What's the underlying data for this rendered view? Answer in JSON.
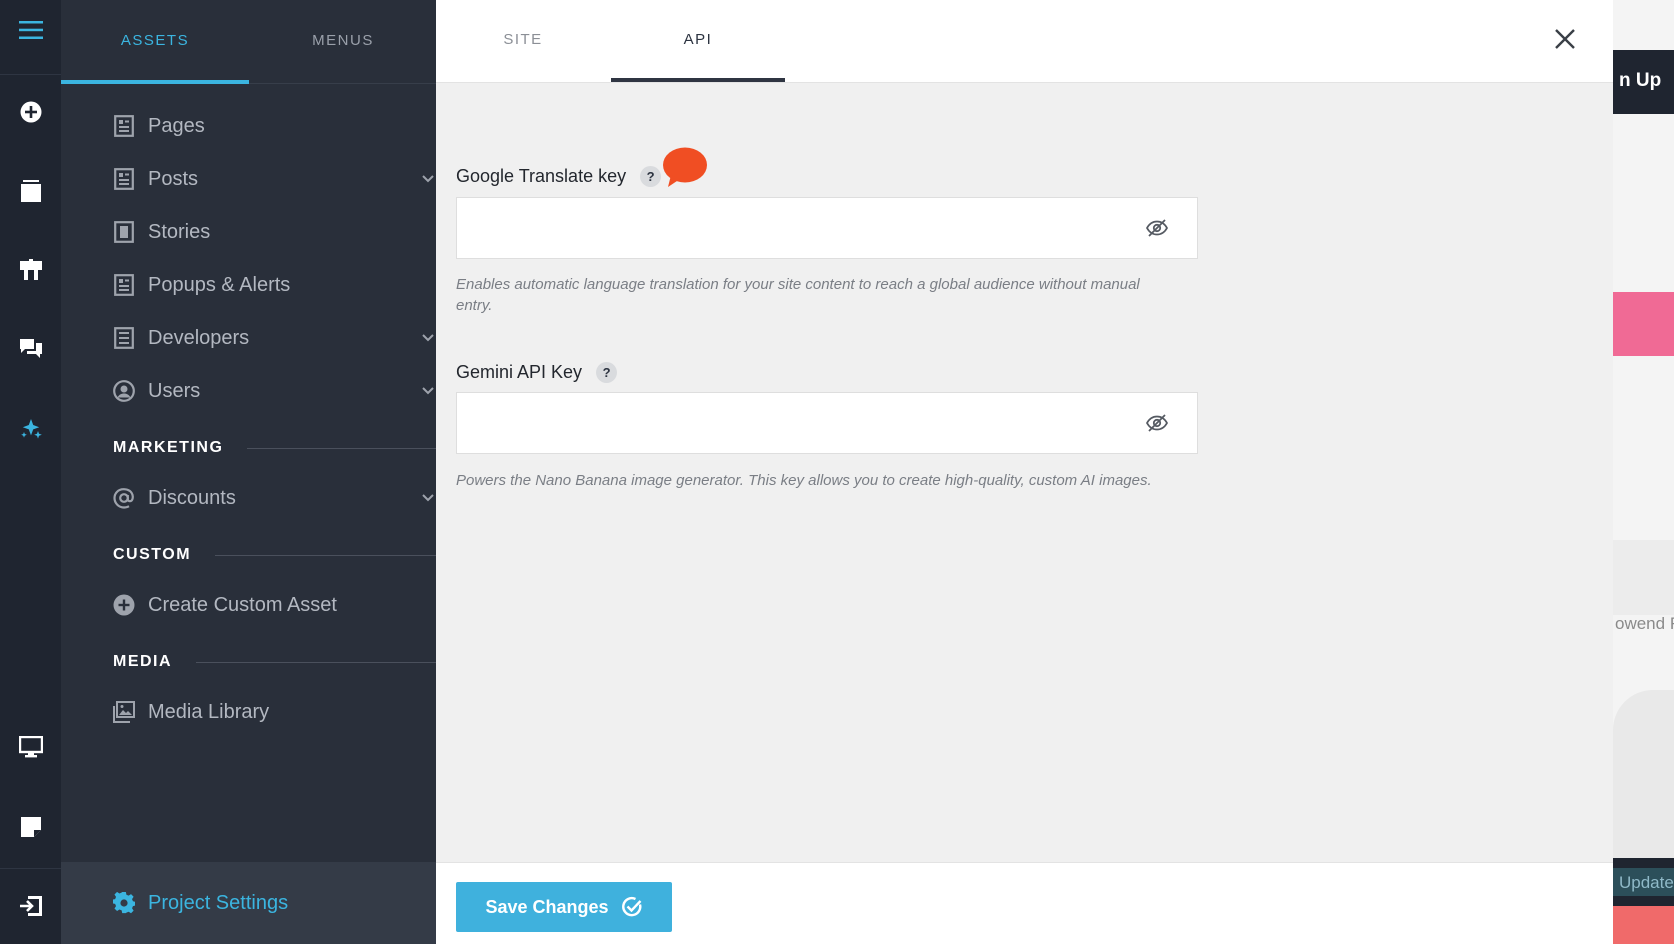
{
  "sidebar": {
    "tabs": [
      {
        "label": "ASSETS",
        "active": true
      },
      {
        "label": "MENUS",
        "active": false
      }
    ],
    "items": [
      {
        "label": "Pages",
        "icon": "page-icon",
        "has_children": false
      },
      {
        "label": "Posts",
        "icon": "page-icon",
        "has_children": true
      },
      {
        "label": "Stories",
        "icon": "story-icon",
        "has_children": false
      },
      {
        "label": "Popups & Alerts",
        "icon": "page-icon",
        "has_children": false
      },
      {
        "label": "Developers",
        "icon": "page-icon",
        "has_children": true
      },
      {
        "label": "Users",
        "icon": "user-circle-icon",
        "has_children": true
      }
    ],
    "sections": {
      "marketing": "MARKETING",
      "custom": "CUSTOM",
      "media": "MEDIA"
    },
    "marketing_items": [
      {
        "label": "Discounts",
        "icon": "at-icon",
        "has_children": true
      }
    ],
    "custom_items": [
      {
        "label": "Create Custom Asset",
        "icon": "plus-circle-icon"
      }
    ],
    "media_items": [
      {
        "label": "Media Library",
        "icon": "gallery-icon"
      }
    ],
    "footer": {
      "label": "Project Settings",
      "icon": "gear-icon"
    }
  },
  "rail": {
    "icons": [
      "hamburger-menu-icon",
      "add-circle-icon",
      "layers-icon",
      "tools-icon",
      "chat-icon",
      "sparkles-icon",
      "desktop-icon",
      "note-icon",
      "exit-icon"
    ],
    "accent": "#3bb5e0"
  },
  "main": {
    "tabs": [
      {
        "label": "SITE",
        "active": false
      },
      {
        "label": "API",
        "active": true
      }
    ],
    "fields": [
      {
        "label": "Google Translate key",
        "help": "?",
        "value": "",
        "hint": "Enables automatic language translation for your site content to reach a global audience without manual entry."
      },
      {
        "label": "Gemini API Key",
        "help": "?",
        "value": "",
        "hint": "Powers the Nano Banana image generator. This key allows you to create high-quality, custom AI images."
      }
    ],
    "save_label": "Save Changes"
  },
  "background_page": {
    "button_text": "n Up",
    "text_snippet": "owend F",
    "update_text": "Update"
  },
  "colors": {
    "accent": "#3bb5e0",
    "rail_bg": "#1f2530",
    "sidebar_bg": "#292f3a",
    "save_button": "#3fb1dd",
    "notification_bubble": "#f04e23",
    "background_pink": "#f06a95"
  }
}
